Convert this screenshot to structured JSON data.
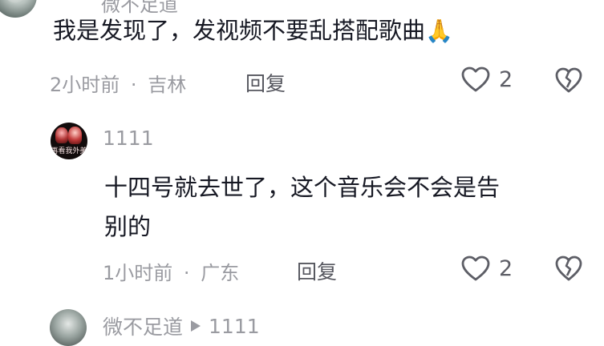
{
  "comments": [
    {
      "username": "微不足道",
      "text": "我是发现了，发视频不要乱搭配歌曲",
      "emoji": "🙏",
      "time": "2小时前",
      "separator": "·",
      "location": "吉林",
      "reply_label": "回复",
      "like_count": "2"
    },
    {
      "username": "1111",
      "text_line1": "十四号就去世了，这个音乐会不会是告",
      "text_line2": "别的",
      "avatar_caption": "再看我外美",
      "time": "1小时前",
      "separator": "·",
      "location": "广东",
      "reply_label": "回复",
      "like_count": "2"
    },
    {
      "username": "微不足道",
      "reply_to": "1111"
    }
  ],
  "icons": {
    "like": "heart-outline-icon",
    "dislike": "broken-heart-icon",
    "reply_arrow": "play-triangle-icon"
  },
  "colors": {
    "text": "#161823",
    "meta": "#9a9ba1",
    "icon": "#5d5e66"
  }
}
